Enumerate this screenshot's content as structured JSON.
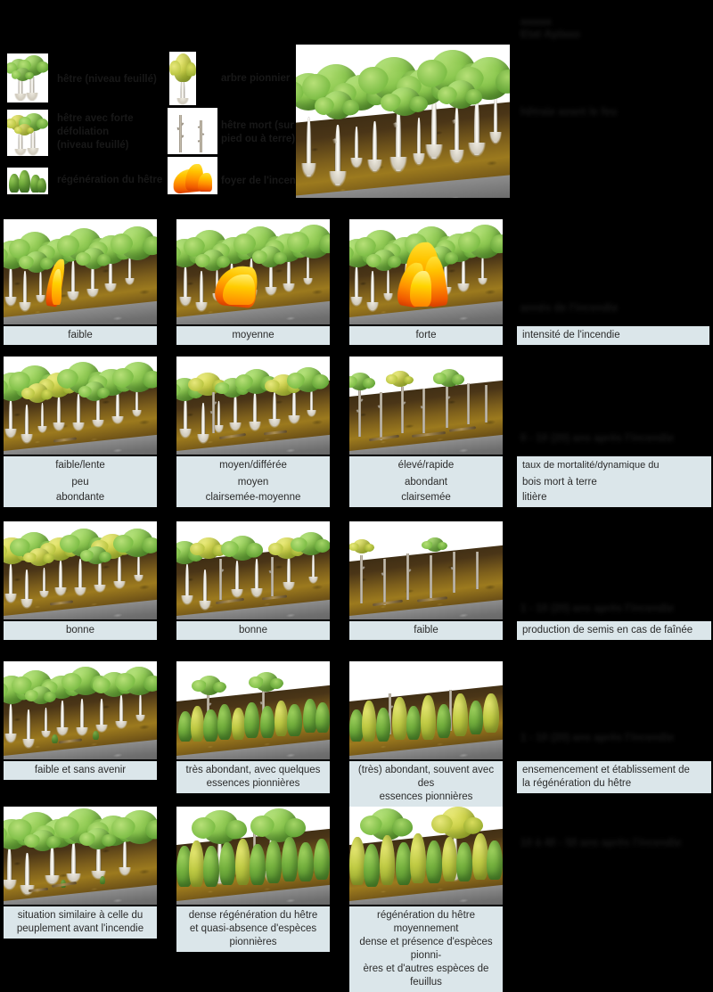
{
  "document": {
    "top_heading_line1": "aaaaa",
    "top_heading_line2": "Etat Aplaas",
    "legend_items": [
      {
        "icon": "beech-tree-green-icon",
        "label": "hêtre (niveau feuillé)"
      },
      {
        "icon": "beech-tree-stressed-icon",
        "label": "hêtre avec forte\ndéfoliation\n(niveau feuillé)"
      },
      {
        "icon": "regeneration-shrub-icon",
        "label": "régénération du hêtre"
      },
      {
        "icon": "pioneer-tree-icon",
        "label": "arbre pionnier"
      },
      {
        "icon": "dead-tree-icon",
        "label": "hêtre mort (sur\npied ou à terre)"
      },
      {
        "icon": "flame-icon",
        "label": "foyer de l'incendie"
      }
    ],
    "initial_state_label": "hêtraie avant le feu"
  },
  "rows": [
    {
      "id": "initial",
      "right_heading": "hêtraie avant le feu",
      "right_caption": null,
      "panels": []
    },
    {
      "id": "fire-intensity",
      "right_heading": "annés de l'incendie",
      "right_captions": [
        "intensité de l'incendie"
      ],
      "panels": [
        {
          "captions": [
            "faible"
          ]
        },
        {
          "captions": [
            "moyenne"
          ]
        },
        {
          "captions": [
            "forte"
          ]
        }
      ]
    },
    {
      "id": "mortality",
      "right_heading": "0 - 10 (20) ans après l'incendie",
      "right_captions": [
        "taux de mortalité/dynamique du peuplement",
        "bois mort à terre",
        "litière"
      ],
      "panels": [
        {
          "captions": [
            "faible/lente",
            "peu",
            "abondante"
          ]
        },
        {
          "captions": [
            "moyen/différée",
            "moyen",
            "clairsemée-moyenne"
          ]
        },
        {
          "captions": [
            "élevé/rapide",
            "abondant",
            "clairsemée"
          ]
        }
      ]
    },
    {
      "id": "seed-production",
      "right_heading": "1 - 10 (20) ans après l'incendie",
      "right_captions": [
        "production de semis en cas de faînée"
      ],
      "panels": [
        {
          "captions": [
            "bonne"
          ]
        },
        {
          "captions": [
            "bonne"
          ]
        },
        {
          "captions": [
            "faible"
          ]
        }
      ]
    },
    {
      "id": "establishment",
      "right_heading": "1 - 10 (20) ans après l'incendie",
      "right_captions": [
        "ensemencement et établissement de\nla régénération du hêtre"
      ],
      "panels": [
        {
          "captions": [
            "faible et sans avenir"
          ]
        },
        {
          "captions": [
            "très abondant, avec quelques\nessences pionnières"
          ]
        },
        {
          "captions": [
            "(très) abondant, souvent avec des\nessences pionnières"
          ]
        }
      ]
    },
    {
      "id": "long-term",
      "right_heading": "10 à 40 - 50 ans après l'incendie",
      "right_captions": [],
      "panels": [
        {
          "captions": [
            "situation similaire à celle du\npeuplement avant l'incendie"
          ]
        },
        {
          "captions": [
            "dense régénération du hêtre\net quasi-absence d'espèces\npionnières"
          ]
        },
        {
          "captions": [
            "régénération du hêtre moyennement\ndense et présence d'espèces pionni-\nères et d'autres espèces de feuillus"
          ]
        }
      ]
    }
  ],
  "colors": {
    "caption_background": "#dbe6ea",
    "caption_text": "#2b2b2b",
    "page_background": "#000000",
    "panel_background": "#ffffff",
    "canopy_green": "#8cc850",
    "canopy_yellow": "#ccd24a",
    "soil_brown": "#9c7a1e",
    "rock_grey": "#6f6f6f",
    "flame_orange": "#ff9000"
  }
}
